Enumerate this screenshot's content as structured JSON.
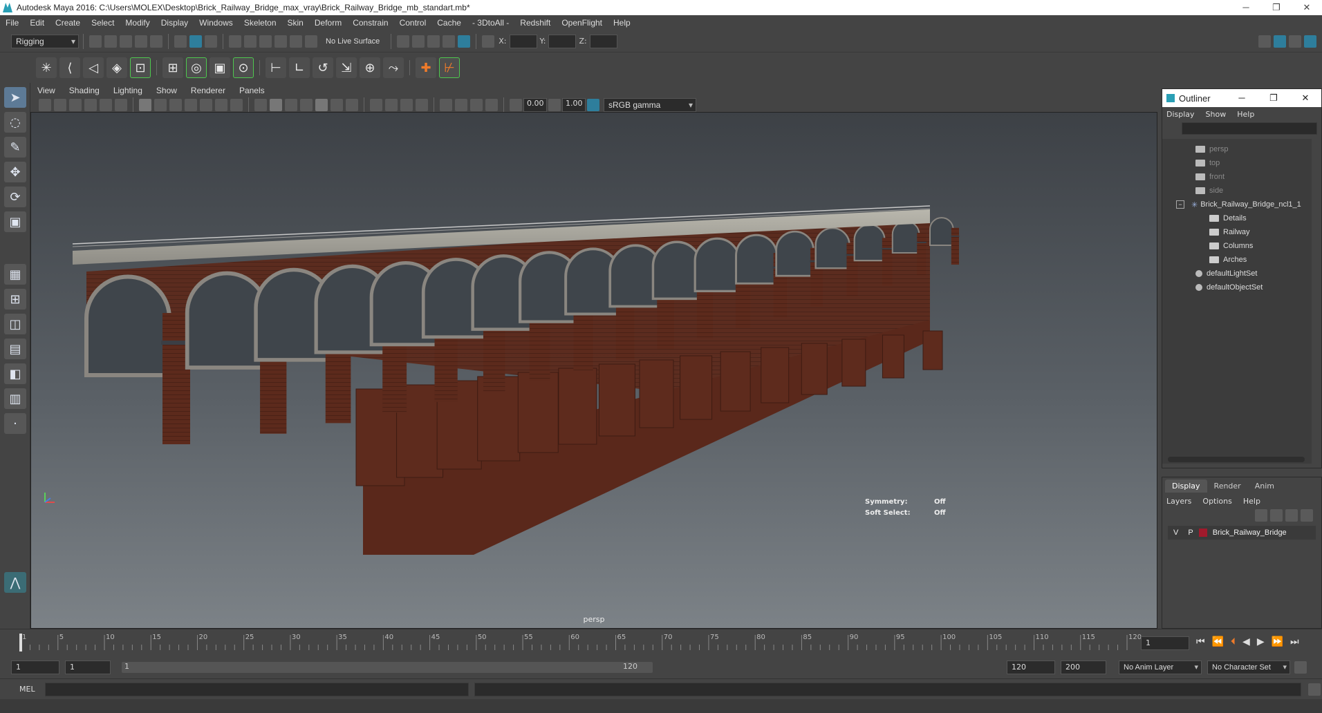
{
  "window": {
    "title": "Autodesk Maya 2016: C:\\Users\\MOLEX\\Desktop\\Brick_Railway_Bridge_max_vray\\Brick_Railway_Bridge_mb_standart.mb*",
    "controls": [
      "─",
      "❐",
      "✕"
    ]
  },
  "menubar": [
    "File",
    "Edit",
    "Create",
    "Select",
    "Modify",
    "Display",
    "Windows",
    "Skeleton",
    "Skin",
    "Deform",
    "Constrain",
    "Control",
    "Cache",
    "- 3DtoAll -",
    "Redshift",
    "OpenFlight",
    "Help"
  ],
  "statusline": {
    "mode": "Rigging",
    "live_surface": "No Live Surface",
    "x_label": "X:",
    "y_label": "Y:",
    "z_label": "Z:"
  },
  "viewport": {
    "menus": [
      "View",
      "Shading",
      "Lighting",
      "Show",
      "Renderer",
      "Panels"
    ],
    "exposure": "0.00",
    "gamma": "1.00",
    "color_space": "sRGB gamma",
    "camera_label": "persp",
    "hud": {
      "symmetry_label": "Symmetry:",
      "symmetry_value": "Off",
      "soft_select_label": "Soft Select:",
      "soft_select_value": "Off"
    }
  },
  "outliner": {
    "title": "Outliner",
    "menus": [
      "Display",
      "Show",
      "Help"
    ],
    "items": [
      {
        "label": "persp",
        "dim": true
      },
      {
        "label": "top",
        "dim": true
      },
      {
        "label": "front",
        "dim": true
      },
      {
        "label": "side",
        "dim": true
      },
      {
        "label": "Brick_Railway_Bridge_ncl1_1",
        "dim": false
      },
      {
        "label": "Details",
        "dim": false
      },
      {
        "label": "Railway",
        "dim": false
      },
      {
        "label": "Columns",
        "dim": false
      },
      {
        "label": "Arches",
        "dim": false
      },
      {
        "label": "defaultLightSet",
        "dim": false
      },
      {
        "label": "defaultObjectSet",
        "dim": false
      }
    ]
  },
  "channel": {
    "tabs": [
      "Display",
      "Render",
      "Anim"
    ],
    "menus": [
      "Layers",
      "Options",
      "Help"
    ],
    "layer": {
      "v": "V",
      "p": "P",
      "name": "Brick_Railway_Bridge",
      "color": "#a01a2c"
    }
  },
  "timeline": {
    "ticks": [
      "1",
      "5",
      "10",
      "15",
      "20",
      "25",
      "30",
      "35",
      "40",
      "45",
      "50",
      "55",
      "60",
      "65",
      "70",
      "75",
      "80",
      "85",
      "90",
      "95",
      "100",
      "105",
      "110",
      "115",
      "120"
    ],
    "current_frame": "1"
  },
  "range": {
    "start": "1",
    "anim_start": "1",
    "slider_start": "1",
    "slider_end": "120",
    "anim_end": "120",
    "end": "200",
    "anim_layer": "No Anim Layer",
    "char_set": "No Character Set"
  },
  "cmdline": {
    "label": "MEL"
  }
}
